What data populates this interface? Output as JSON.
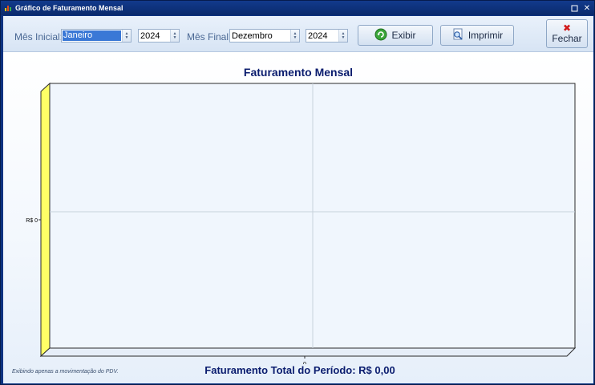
{
  "window": {
    "title": "Gráfico de Faturamento Mensal",
    "controls": [
      "minimize",
      "close"
    ]
  },
  "toolbar": {
    "start_month_label": "Mês Inicial:",
    "start_month_value": "Janeiro",
    "start_year_value": "2024",
    "end_month_label": "Mês Final:",
    "end_month_value": "Dezembro",
    "end_year_value": "2024",
    "show_label": "Exibir",
    "print_label": "Imprimir",
    "close_label": "Fechar"
  },
  "chart_data": {
    "type": "bar",
    "title": "Faturamento Mensal",
    "categories": [],
    "values": [],
    "y_tick_labels": [
      "R$ 0"
    ],
    "x_tick_labels": [
      "0"
    ],
    "grid": true,
    "legend": "none",
    "colors": {
      "axis_wall": "#ffff66",
      "grid": "#c8d2dc",
      "title": "#0a1c6e"
    }
  },
  "footer": {
    "note": "Exibindo apenas a movimentação do PDV.",
    "total_text": "Faturamento Total do Período: R$ 0,00"
  }
}
